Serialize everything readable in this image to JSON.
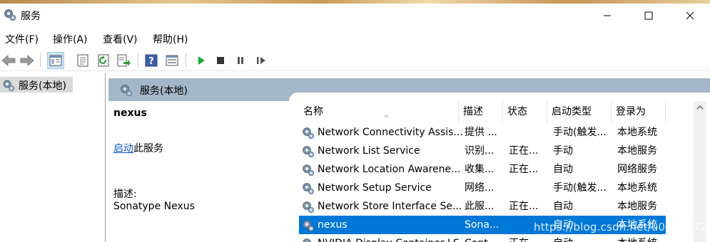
{
  "window": {
    "title": "服务",
    "min_icon": "minimize-icon",
    "max_icon": "maximize-icon",
    "close_icon": "close-icon"
  },
  "menu": {
    "items": [
      {
        "label": "文件(F)"
      },
      {
        "label": "操作(A)"
      },
      {
        "label": "查看(V)"
      },
      {
        "label": "帮助(H)"
      }
    ]
  },
  "toolbar": {
    "icons": [
      "back-icon",
      "forward-icon",
      "show-hide-tree-icon",
      "properties-icon",
      "refresh-icon",
      "export-list-icon",
      "help-icon",
      "show-console-icon",
      "start-service-icon",
      "stop-service-icon",
      "pause-service-icon",
      "restart-service-icon"
    ]
  },
  "tree": {
    "root_label": "服务(本地)"
  },
  "header_band": {
    "label": "服务(本地)"
  },
  "detail": {
    "name": "nexus",
    "start_link": "启动",
    "start_suffix": "此服务",
    "desc_label": "描述:",
    "desc_text": "Sonatype Nexus"
  },
  "table": {
    "columns": [
      {
        "label": "名称"
      },
      {
        "label": "描述"
      },
      {
        "label": "状态"
      },
      {
        "label": "启动类型"
      },
      {
        "label": "登录为"
      }
    ],
    "rows": [
      {
        "name": "Network Connectivity Assis...",
        "desc": "提供 ...",
        "status": "",
        "startup": "手动(触发...",
        "logon": "本地系统"
      },
      {
        "name": "Network List Service",
        "desc": "识别...",
        "status": "正在...",
        "startup": "手动",
        "logon": "本地服务"
      },
      {
        "name": "Network Location Awarene...",
        "desc": "收集...",
        "status": "正在...",
        "startup": "自动",
        "logon": "网络服务"
      },
      {
        "name": "Network Setup Service",
        "desc": "网络...",
        "status": "",
        "startup": "手动(触发...",
        "logon": "本地系统"
      },
      {
        "name": "Network Store Interface Se...",
        "desc": "此服...",
        "status": "正在...",
        "startup": "自动",
        "logon": "本地服务"
      },
      {
        "name": "nexus",
        "desc": "Sona...",
        "status": "",
        "startup": "自动",
        "logon": "本地系统",
        "selected": true
      },
      {
        "name": "NVIDIA Display Container LS",
        "desc": "Cont...",
        "status": "正在...",
        "startup": "自动",
        "logon": "本地系统"
      }
    ]
  },
  "watermark": "https://blog.csdn.net/u013957201",
  "colors": {
    "selection": "#0078d7",
    "header_band": "#a4b6c9",
    "link": "#0a5bd6"
  }
}
